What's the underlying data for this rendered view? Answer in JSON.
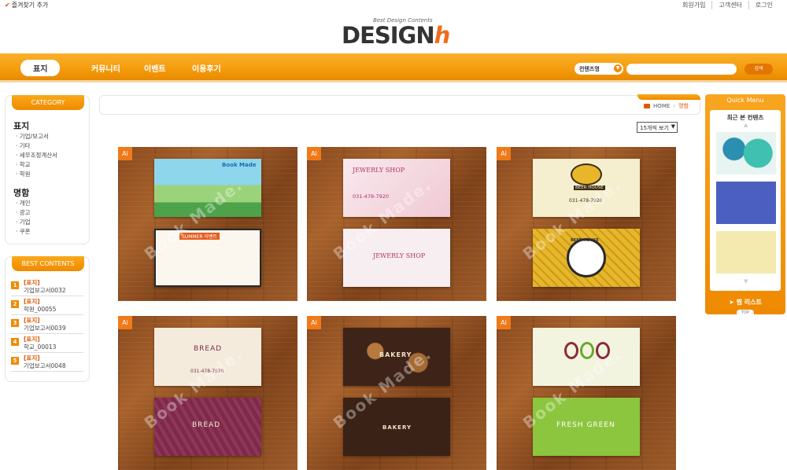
{
  "topbar": {
    "favorite": "즐겨찾기 추가",
    "links": [
      "회원가입",
      "고객센터",
      "로그인"
    ]
  },
  "logo": {
    "tagline": "Best Design Contents",
    "text_main": "DESIGN",
    "text_accent": "h"
  },
  "nav": {
    "items": [
      "표지",
      "커뮤니티",
      "이벤트",
      "이용후기"
    ],
    "active": "표지"
  },
  "search": {
    "scope": "컨텐츠명",
    "placeholder": "",
    "button": "검색"
  },
  "category": {
    "title": "CATEGORY",
    "groups": [
      {
        "name": "표지",
        "items": [
          "기업/보고서",
          "기타",
          "세무조정계산서",
          "학교",
          "학원"
        ]
      },
      {
        "name": "명함",
        "items": [
          "개인",
          "광고",
          "기업",
          "쿠폰"
        ]
      }
    ]
  },
  "best": {
    "title": "BEST CONTENTS",
    "items": [
      {
        "rank": "1",
        "cat": "[표지]",
        "name": "기업보고서0032"
      },
      {
        "rank": "2",
        "cat": "[표지]",
        "name": "학원_00055"
      },
      {
        "rank": "3",
        "cat": "[표지]",
        "name": "기업보고서0039"
      },
      {
        "rank": "4",
        "cat": "[표지]",
        "name": "학교_00013"
      },
      {
        "rank": "5",
        "cat": "[표지]",
        "name": "기업보고서0048"
      }
    ]
  },
  "breadcrumb": {
    "home": "HOME",
    "current": "명함"
  },
  "view_select": "15개씩 보기",
  "products": [
    {
      "badge": "Ai",
      "watermark": "Book Made.",
      "top_text": "Book Made",
      "bottom_text": "SUMMER 이벤트",
      "colors": {
        "top": "#7fd3e8",
        "bottom": "#fbf7ee"
      }
    },
    {
      "badge": "Ai",
      "watermark": "Book Made.",
      "top_text": "JEWERLY SHOP",
      "bottom_text": "JEWERLY SHOP",
      "phone": "031-478-7920",
      "colors": {
        "top": "#f4d5dd",
        "bottom": "#f8eef0"
      }
    },
    {
      "badge": "Ai",
      "watermark": "Book Made.",
      "top_text": "BEER HOUSE",
      "bottom_text": "BEER HOUSE",
      "phone": "031-478-7920",
      "colors": {
        "top": "#f6efcf",
        "bottom": "#e7b62a"
      }
    },
    {
      "badge": "Ai",
      "watermark": "Book Made.",
      "top_text": "BREAD",
      "bottom_text": "BREAD",
      "phone": "031-478-7920",
      "colors": {
        "top": "#f4ebdd",
        "bottom": "#7d2a4a"
      }
    },
    {
      "badge": "Ai",
      "watermark": "Book Made.",
      "top_text": "BAKERY",
      "bottom_text": "BAKERY",
      "colors": {
        "top": "#3e2418",
        "bottom": "#3a2216"
      }
    },
    {
      "badge": "Ai",
      "watermark": "Book Made.",
      "top_text": "",
      "bottom_text": "FRESH GREEN",
      "colors": {
        "top": "#f2f4e0",
        "bottom": "#8cc63e"
      }
    }
  ],
  "quick_menu": {
    "title": "Quick Menu",
    "recent": "최근 본 컨텐츠",
    "wish": "찜 리스트",
    "top": "TOP"
  }
}
